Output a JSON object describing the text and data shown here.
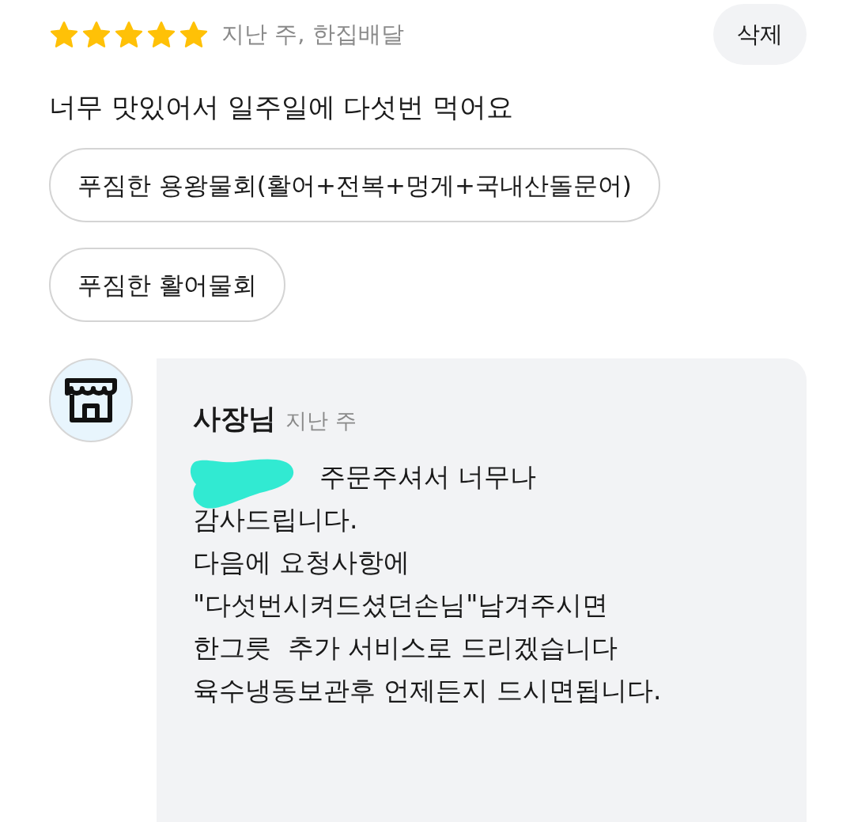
{
  "review": {
    "stars": 5,
    "meta": "지난 주, 한집배달",
    "delete_button": "삭제",
    "text": "너무 맛있어서 일주일에 다섯번 먹어요",
    "menu_items": [
      "푸짐한 용왕물회(활어+전복+멍게+국내산돌문어)",
      "푸짐한 활어물회"
    ]
  },
  "reply": {
    "author": "사장님",
    "time": "지난 주",
    "redacted": true,
    "body": [
      "주문주셔서 너무나",
      "감사드립니다.\n다음에 요청사항에\n\"다섯번시켜드셨던손님\"남겨주시면\n한그릇  추가 서비스로 드리겠습니다\n육수냉동보관후 언제든지 드시면됩니다."
    ]
  }
}
